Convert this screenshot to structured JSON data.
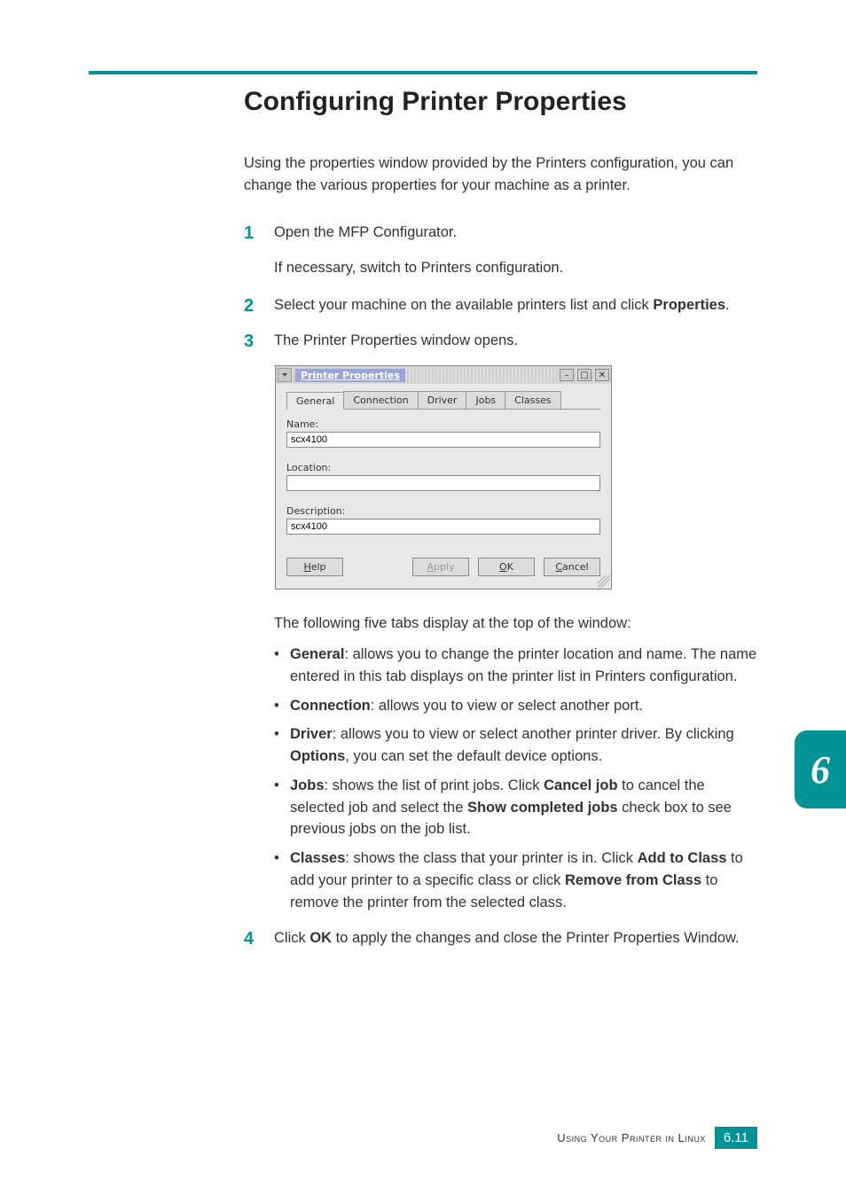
{
  "heading": "Configuring Printer Properties",
  "intro": "Using the properties window provided by the Printers configuration, you can change the various properties for your machine as a printer.",
  "steps": {
    "s1_num": "1",
    "s1_main": "Open the MFP Configurator.",
    "s1_sub": "If necessary, switch to Printers configuration.",
    "s2_num": "2",
    "s2_a": "Select your machine on the available printers list and click ",
    "s2_b": "Properties",
    "s2_c": ".",
    "s3_num": "3",
    "s3_main": "The Printer Properties window opens.",
    "s4_num": "4",
    "s4_a": "Click ",
    "s4_b": "OK",
    "s4_c": " to apply the changes and close the Printer Properties Window."
  },
  "tabs_intro": "The following five tabs display at the top of the window:",
  "bullets": {
    "b1_kw": "General",
    "b1_rest": ": allows you to change the printer location and name. The name entered in this tab displays on the printer list in Printers configuration.",
    "b2_kw": "Connection",
    "b2_rest": ": allows you to view or select another port.",
    "b3_kw": "Driver",
    "b3_a": ": allows you to view or select another printer driver. By clicking ",
    "b3_b": "Options",
    "b3_c": ", you can set the default device options.",
    "b4_kw": "Jobs",
    "b4_a": ": shows the list of print jobs. Click ",
    "b4_b": "Cancel job",
    "b4_c": " to cancel the selected job and select the ",
    "b4_d": "Show completed jobs",
    "b4_e": " check box to see previous jobs on the job list.",
    "b5_kw": "Classes",
    "b5_a": ": shows the class that your printer is in. Click ",
    "b5_b": "Add to Class",
    "b5_c": " to add your printer to a specific class or click ",
    "b5_d": "Remove from Class",
    "b5_e": " to remove the printer from the selected class."
  },
  "dialog": {
    "title": "Printer Properties",
    "tabs": {
      "t1": "General",
      "t2": "Connection",
      "t3": "Driver",
      "t4": "Jobs",
      "t5": "Classes"
    },
    "labels": {
      "name": "Name:",
      "location": "Location:",
      "description": "Description:"
    },
    "values": {
      "name": "scx4100",
      "location": "",
      "description": "scx4100"
    },
    "buttons": {
      "help": "Help",
      "apply": "Apply",
      "ok": "OK",
      "cancel": "Cancel"
    },
    "under": {
      "help_u": "H",
      "help_r": "elp",
      "apply_u": "A",
      "apply_r": "pply",
      "ok_u": "O",
      "ok_r": "K",
      "cancel_u": "C",
      "cancel_r": "ancel"
    }
  },
  "sidechapter": "6",
  "footer": {
    "text": "Using Your Printer in Linux",
    "page": "6.11"
  }
}
